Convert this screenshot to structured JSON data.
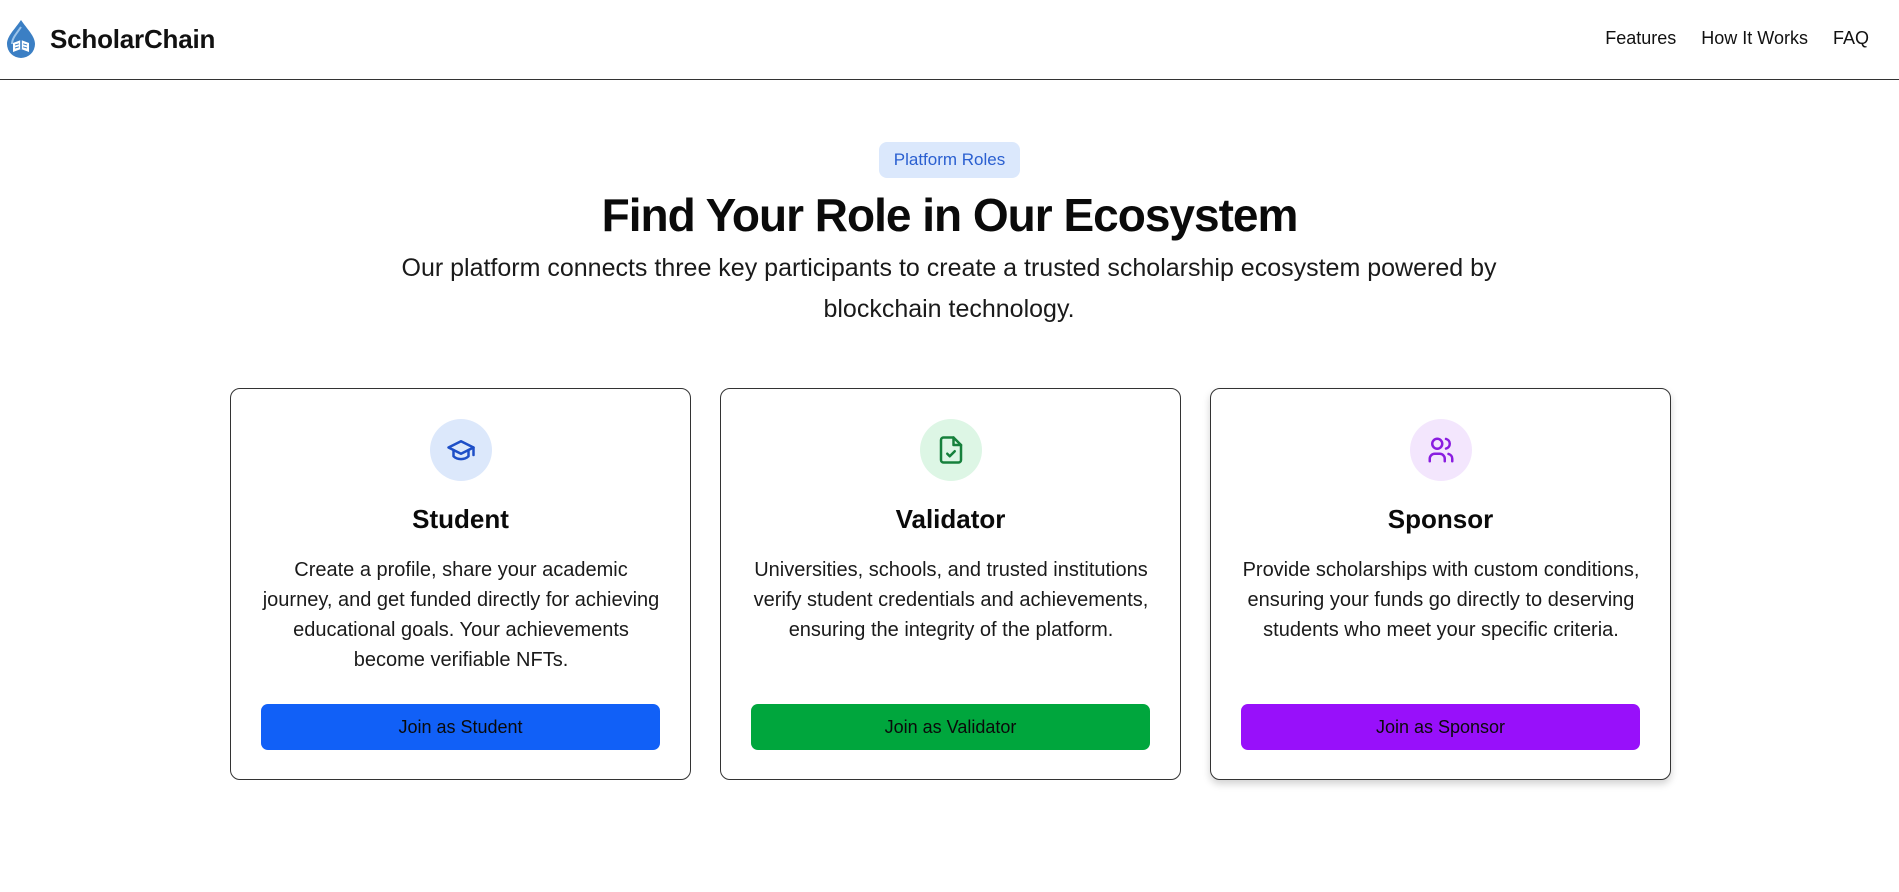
{
  "header": {
    "brand_name": "ScholarChain",
    "logo_icon": "water-drop-book-logo",
    "nav": [
      {
        "label": "Features"
      },
      {
        "label": "How It Works"
      },
      {
        "label": "FAQ"
      }
    ]
  },
  "section": {
    "badge": "Platform Roles",
    "title": "Find Your Role in Our Ecosystem",
    "subtitle": "Our platform connects three key participants to create a trusted scholarship ecosystem powered by blockchain technology."
  },
  "roles": [
    {
      "title": "Student",
      "icon": "graduation-cap-icon",
      "description": "Create a profile, share your academic journey, and get funded directly for achieving educational goals. Your achievements become verifiable NFTs.",
      "button": "Join as Student",
      "accent": "#1160f7",
      "icon_bg": "#dce8fb",
      "icon_color": "#1e4fc7"
    },
    {
      "title": "Validator",
      "icon": "file-check-icon",
      "description": "Universities, schools, and trusted institutions verify student credentials and achievements, ensuring the integrity of the platform.",
      "button": "Join as Validator",
      "accent": "#00a63d",
      "icon_bg": "#ddf6e5",
      "icon_color": "#16803c"
    },
    {
      "title": "Sponsor",
      "icon": "users-icon",
      "description": "Provide scholarships with custom conditions, ensuring your funds go directly to deserving students who meet your specific criteria.",
      "button": "Join as Sponsor",
      "accent": "#9810fa",
      "icon_bg": "#f3e6fd",
      "icon_color": "#8a1de0"
    }
  ]
}
